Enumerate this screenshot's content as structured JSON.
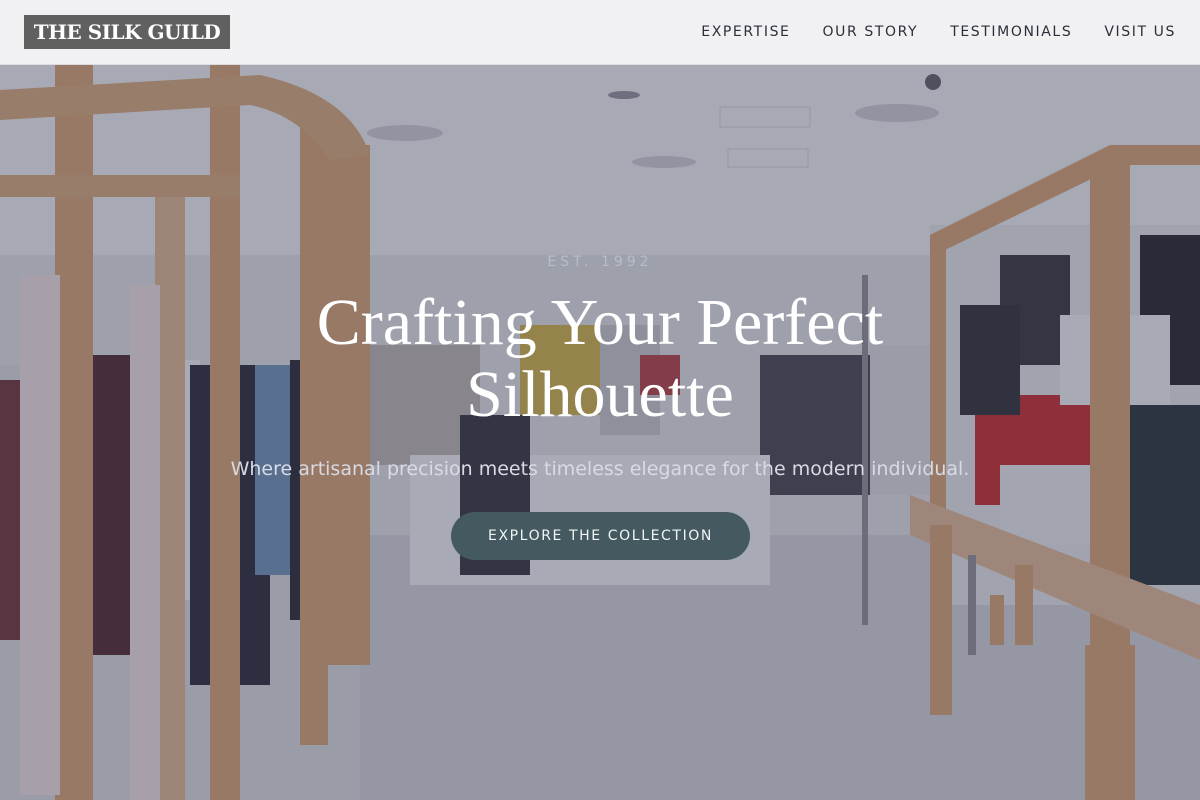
{
  "header": {
    "brand": "THE SILK GUILD",
    "nav": [
      {
        "label": "EXPERTISE"
      },
      {
        "label": "OUR STORY"
      },
      {
        "label": "TESTIMONIALS"
      },
      {
        "label": "VISIT US"
      }
    ]
  },
  "hero": {
    "eyebrow": "EST. 1992",
    "title": "Crafting Your Perfect Silhouette",
    "subtitle": "Where artisanal precision meets timeless elegance for the modern individual.",
    "cta_label": "EXPLORE THE COLLECTION"
  }
}
